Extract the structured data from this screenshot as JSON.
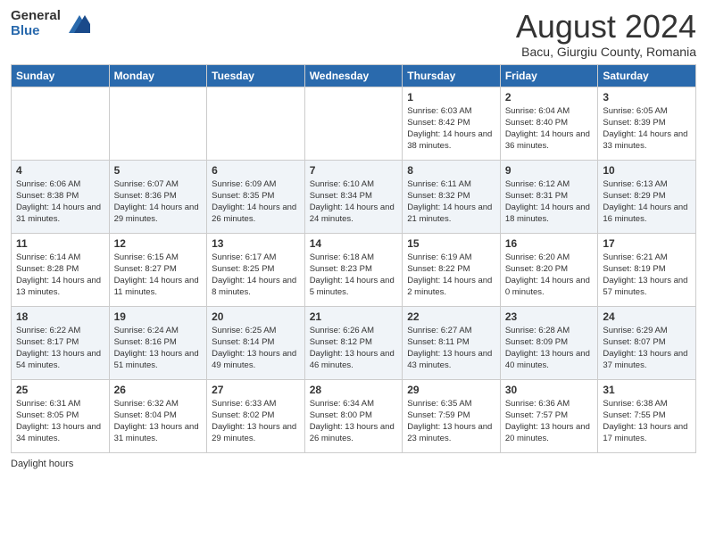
{
  "header": {
    "logo_general": "General",
    "logo_blue": "Blue",
    "month_title": "August 2024",
    "subtitle": "Bacu, Giurgiu County, Romania"
  },
  "days_of_week": [
    "Sunday",
    "Monday",
    "Tuesday",
    "Wednesday",
    "Thursday",
    "Friday",
    "Saturday"
  ],
  "footer": {
    "daylight_hours": "Daylight hours"
  },
  "weeks": [
    [
      {
        "day": "",
        "info": ""
      },
      {
        "day": "",
        "info": ""
      },
      {
        "day": "",
        "info": ""
      },
      {
        "day": "",
        "info": ""
      },
      {
        "day": "1",
        "info": "Sunrise: 6:03 AM\nSunset: 8:42 PM\nDaylight: 14 hours and 38 minutes."
      },
      {
        "day": "2",
        "info": "Sunrise: 6:04 AM\nSunset: 8:40 PM\nDaylight: 14 hours and 36 minutes."
      },
      {
        "day": "3",
        "info": "Sunrise: 6:05 AM\nSunset: 8:39 PM\nDaylight: 14 hours and 33 minutes."
      }
    ],
    [
      {
        "day": "4",
        "info": "Sunrise: 6:06 AM\nSunset: 8:38 PM\nDaylight: 14 hours and 31 minutes."
      },
      {
        "day": "5",
        "info": "Sunrise: 6:07 AM\nSunset: 8:36 PM\nDaylight: 14 hours and 29 minutes."
      },
      {
        "day": "6",
        "info": "Sunrise: 6:09 AM\nSunset: 8:35 PM\nDaylight: 14 hours and 26 minutes."
      },
      {
        "day": "7",
        "info": "Sunrise: 6:10 AM\nSunset: 8:34 PM\nDaylight: 14 hours and 24 minutes."
      },
      {
        "day": "8",
        "info": "Sunrise: 6:11 AM\nSunset: 8:32 PM\nDaylight: 14 hours and 21 minutes."
      },
      {
        "day": "9",
        "info": "Sunrise: 6:12 AM\nSunset: 8:31 PM\nDaylight: 14 hours and 18 minutes."
      },
      {
        "day": "10",
        "info": "Sunrise: 6:13 AM\nSunset: 8:29 PM\nDaylight: 14 hours and 16 minutes."
      }
    ],
    [
      {
        "day": "11",
        "info": "Sunrise: 6:14 AM\nSunset: 8:28 PM\nDaylight: 14 hours and 13 minutes."
      },
      {
        "day": "12",
        "info": "Sunrise: 6:15 AM\nSunset: 8:27 PM\nDaylight: 14 hours and 11 minutes."
      },
      {
        "day": "13",
        "info": "Sunrise: 6:17 AM\nSunset: 8:25 PM\nDaylight: 14 hours and 8 minutes."
      },
      {
        "day": "14",
        "info": "Sunrise: 6:18 AM\nSunset: 8:23 PM\nDaylight: 14 hours and 5 minutes."
      },
      {
        "day": "15",
        "info": "Sunrise: 6:19 AM\nSunset: 8:22 PM\nDaylight: 14 hours and 2 minutes."
      },
      {
        "day": "16",
        "info": "Sunrise: 6:20 AM\nSunset: 8:20 PM\nDaylight: 14 hours and 0 minutes."
      },
      {
        "day": "17",
        "info": "Sunrise: 6:21 AM\nSunset: 8:19 PM\nDaylight: 13 hours and 57 minutes."
      }
    ],
    [
      {
        "day": "18",
        "info": "Sunrise: 6:22 AM\nSunset: 8:17 PM\nDaylight: 13 hours and 54 minutes."
      },
      {
        "day": "19",
        "info": "Sunrise: 6:24 AM\nSunset: 8:16 PM\nDaylight: 13 hours and 51 minutes."
      },
      {
        "day": "20",
        "info": "Sunrise: 6:25 AM\nSunset: 8:14 PM\nDaylight: 13 hours and 49 minutes."
      },
      {
        "day": "21",
        "info": "Sunrise: 6:26 AM\nSunset: 8:12 PM\nDaylight: 13 hours and 46 minutes."
      },
      {
        "day": "22",
        "info": "Sunrise: 6:27 AM\nSunset: 8:11 PM\nDaylight: 13 hours and 43 minutes."
      },
      {
        "day": "23",
        "info": "Sunrise: 6:28 AM\nSunset: 8:09 PM\nDaylight: 13 hours and 40 minutes."
      },
      {
        "day": "24",
        "info": "Sunrise: 6:29 AM\nSunset: 8:07 PM\nDaylight: 13 hours and 37 minutes."
      }
    ],
    [
      {
        "day": "25",
        "info": "Sunrise: 6:31 AM\nSunset: 8:05 PM\nDaylight: 13 hours and 34 minutes."
      },
      {
        "day": "26",
        "info": "Sunrise: 6:32 AM\nSunset: 8:04 PM\nDaylight: 13 hours and 31 minutes."
      },
      {
        "day": "27",
        "info": "Sunrise: 6:33 AM\nSunset: 8:02 PM\nDaylight: 13 hours and 29 minutes."
      },
      {
        "day": "28",
        "info": "Sunrise: 6:34 AM\nSunset: 8:00 PM\nDaylight: 13 hours and 26 minutes."
      },
      {
        "day": "29",
        "info": "Sunrise: 6:35 AM\nSunset: 7:59 PM\nDaylight: 13 hours and 23 minutes."
      },
      {
        "day": "30",
        "info": "Sunrise: 6:36 AM\nSunset: 7:57 PM\nDaylight: 13 hours and 20 minutes."
      },
      {
        "day": "31",
        "info": "Sunrise: 6:38 AM\nSunset: 7:55 PM\nDaylight: 13 hours and 17 minutes."
      }
    ]
  ]
}
